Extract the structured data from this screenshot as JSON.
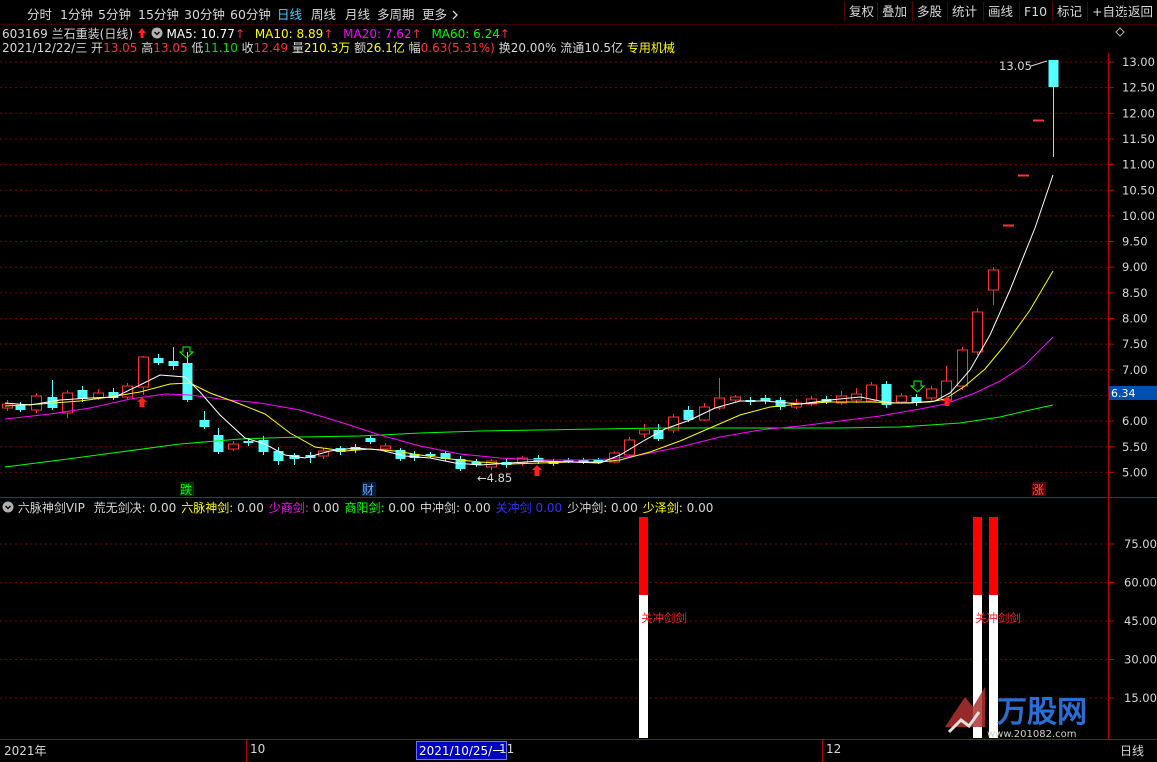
{
  "toolbar": {
    "periods": [
      "分时",
      "1分钟",
      "5分钟",
      "15分钟",
      "30分钟",
      "60分钟",
      "日线",
      "周线",
      "月线",
      "多周期",
      "更多"
    ],
    "active_period": "日线",
    "right_buttons": [
      "复权",
      "叠加",
      "多股",
      "统计",
      "画线",
      "F10",
      "标记",
      "+自选",
      "返回"
    ]
  },
  "stock": {
    "code": "603169",
    "name": "兰石重装",
    "period_label": "(日线)",
    "ma5": "MA5: 10.77",
    "ma10": "MA10: 8.89",
    "ma20": "MA20: 7.62",
    "ma60": "MA60: 6.24",
    "date": "2021/12/22/三",
    "open_label": "开",
    "open": "13.05",
    "high_label": "高",
    "high": "13.05",
    "low_label": "低",
    "low": "11.10",
    "close_label": "收",
    "close": "12.49",
    "vol_label": "量",
    "vol": "210.3万",
    "amount_label": "额",
    "amount": "26.1亿",
    "change_label": "幅",
    "change": "0.63(5.31%)",
    "turnover_label": "换",
    "turnover": "20.00%",
    "float_label": "流通",
    "float": "10.5亿",
    "sector": "专用机械"
  },
  "colors": {
    "up": "#ff3232",
    "down": "#54ffff",
    "ma5": "#ffffff",
    "ma10": "#ffff00",
    "ma20": "#ff00ff",
    "ma60": "#00ff00",
    "grid": "#7a0000",
    "axis": "#c00000"
  },
  "main_chart": {
    "price_axis": [
      "13.00",
      "12.50",
      "12.00",
      "11.50",
      "11.00",
      "10.50",
      "10.00",
      "9.50",
      "9.00",
      "8.50",
      "8.00",
      "7.50",
      "7.00",
      "6.50",
      "6.00",
      "5.50",
      "5.00"
    ],
    "current_ma60_tag": "6.34",
    "high_annotation": "13.05",
    "low_annotation": "←4.85",
    "markers": {
      "fall": "跌",
      "finance": "财",
      "rise": "涨"
    }
  },
  "indicator": {
    "name": "六脉神剑VIP",
    "items": [
      {
        "label": "荒无剑决:",
        "value": "0.00",
        "color": "#d8d8d8"
      },
      {
        "label": "六脉神剑:",
        "value": "0.00",
        "color": "#ffff00"
      },
      {
        "label": "少商剑:",
        "value": "0.00",
        "color": "#ff00ff"
      },
      {
        "label": "商阳剑:",
        "value": "0.00",
        "color": "#00ff00"
      },
      {
        "label": "中冲剑:",
        "value": "0.00",
        "color": "#d8d8d8"
      },
      {
        "label": "关冲剑",
        "value": "0.00",
        "color": "#3232ff"
      },
      {
        "label": "少冲剑:",
        "value": "0.00",
        "color": "#d8d8d8"
      },
      {
        "label": "少泽剑:",
        "value": "0.00",
        "color": "#ffff00"
      }
    ],
    "axis": [
      "75.00",
      "60.00",
      "45.00",
      "30.00",
      "15.00"
    ],
    "bar_label_1": "关冲剑剑",
    "bar_label_2": "关冲剑剑"
  },
  "time_axis": {
    "labels": [
      "2021年",
      "10",
      "2021/10/25/一",
      "11",
      "12"
    ],
    "right_label": "日线"
  },
  "watermark": {
    "brand": "万股网",
    "url": "www.201082.com"
  }
}
